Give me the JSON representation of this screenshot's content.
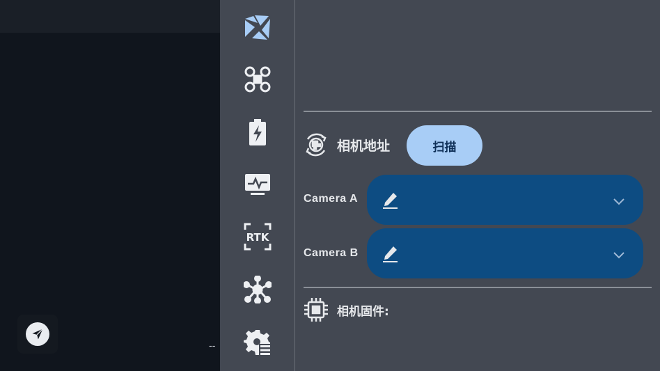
{
  "map_area": {
    "dash_text": "--"
  },
  "sidebar": {
    "items": [
      {
        "name": "camera-settings",
        "icon": "aperture-icon",
        "active": true
      },
      {
        "name": "drone",
        "icon": "drone-icon"
      },
      {
        "name": "battery",
        "icon": "battery-charging-icon"
      },
      {
        "name": "monitor",
        "icon": "monitor-pulse-icon"
      },
      {
        "name": "rtk",
        "icon": "rtk-icon",
        "text": "RTK"
      },
      {
        "name": "network",
        "icon": "hub-icon"
      },
      {
        "name": "settings",
        "icon": "gear-list-icon"
      }
    ]
  },
  "panel": {
    "address_section": {
      "title": "相机地址",
      "scan_label": "扫描"
    },
    "cameras": [
      {
        "label": "Camera A",
        "value": ""
      },
      {
        "label": "Camera B",
        "value": ""
      }
    ],
    "firmware_section": {
      "title": "相机固件:"
    }
  },
  "colors": {
    "panel_bg": "#434852",
    "map_bg": "#10151d",
    "select_bg": "#0d4c82",
    "scan_bg": "#a8cdf6",
    "active_icon": "#a8cdf6"
  }
}
